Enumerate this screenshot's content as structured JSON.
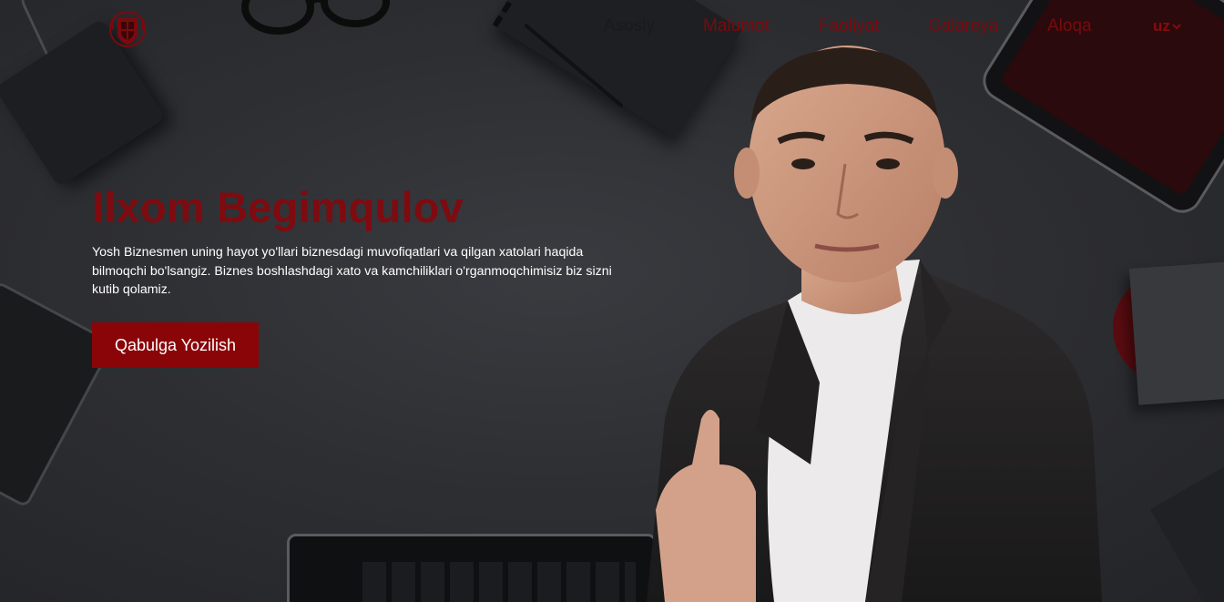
{
  "nav": {
    "items": [
      {
        "label": "Asosiy",
        "active": true
      },
      {
        "label": "Malumot",
        "active": false
      },
      {
        "label": "Faoliyat",
        "active": false
      },
      {
        "label": "Galareya",
        "active": false
      },
      {
        "label": "Aloqa",
        "active": false
      }
    ],
    "language": "uz",
    "language_icon": "chevron-down-icon"
  },
  "logo": {
    "icon": "crest-logo"
  },
  "hero": {
    "title": "Ilxom Begimqulov",
    "description": "Yosh Biznesmen uning hayot yo'llari biznesdagi muvofiqatlari va qilgan xatolari haqida bilmoqchi bo'lsangiz. Biznes boshlashdagi xato va kamchiliklari o'rganmoqchimisiz biz sizni kutib qolamiz.",
    "button_label": "Qabulga Yozilish"
  },
  "colors": {
    "accent": "#8a0508",
    "title": "#7e0b10",
    "nav_link": "#7a0a0e",
    "nav_active": "#1a1a1a",
    "background": "#2b2c30"
  }
}
